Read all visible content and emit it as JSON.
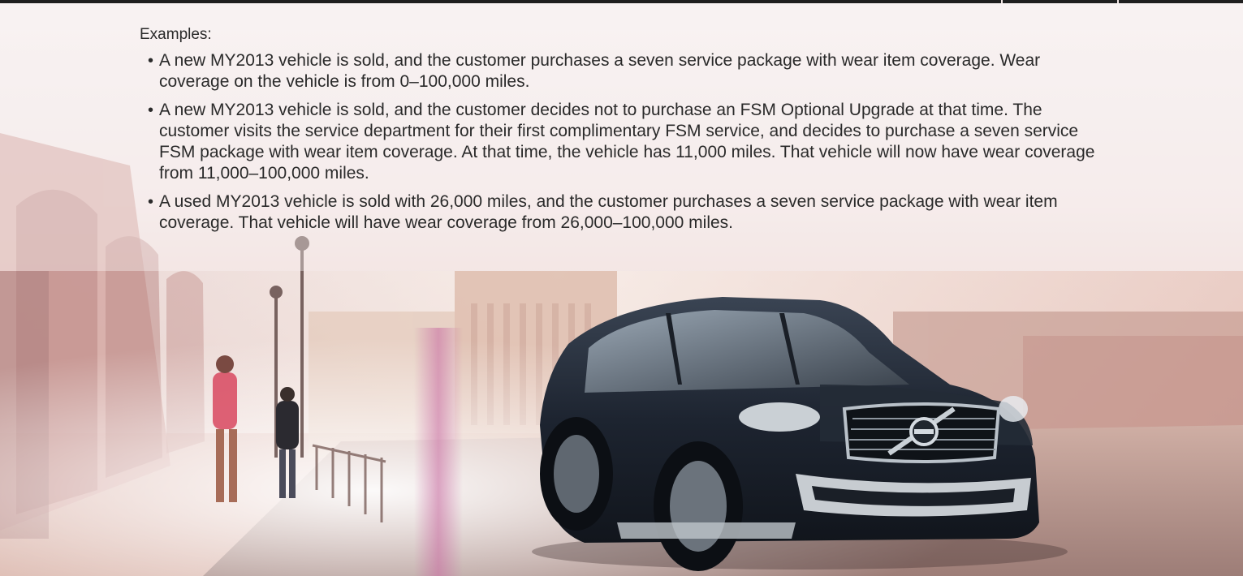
{
  "examples": {
    "heading": "Examples:",
    "items": [
      "A new MY2013 vehicle is sold, and the customer purchases a seven service package with wear item coverage. Wear coverage on the vehicle is from 0–100,000 miles.",
      "A new MY2013 vehicle is sold, and the customer decides not to purchase an FSM Optional Upgrade at that time. The customer visits the service department for their first complimentary FSM service, and decides to purchase a seven service FSM package with wear item coverage. At that time, the vehicle has 11,000 miles. That vehicle will now have wear coverage from 11,000–100,000 miles.",
      "A used MY2013 vehicle is sold with 26,000 miles, and the customer purchases a seven service package with wear item coverage. That vehicle will have wear coverage from 26,000–100,000 miles."
    ]
  },
  "colors": {
    "top_bar": "#1f1f1f",
    "text": "#2a2a2a",
    "vehicle_body": "#1d2430",
    "background_tint": "#f3e7e6"
  },
  "icons": {
    "vehicle_badge": "volvo-badge-icon"
  }
}
